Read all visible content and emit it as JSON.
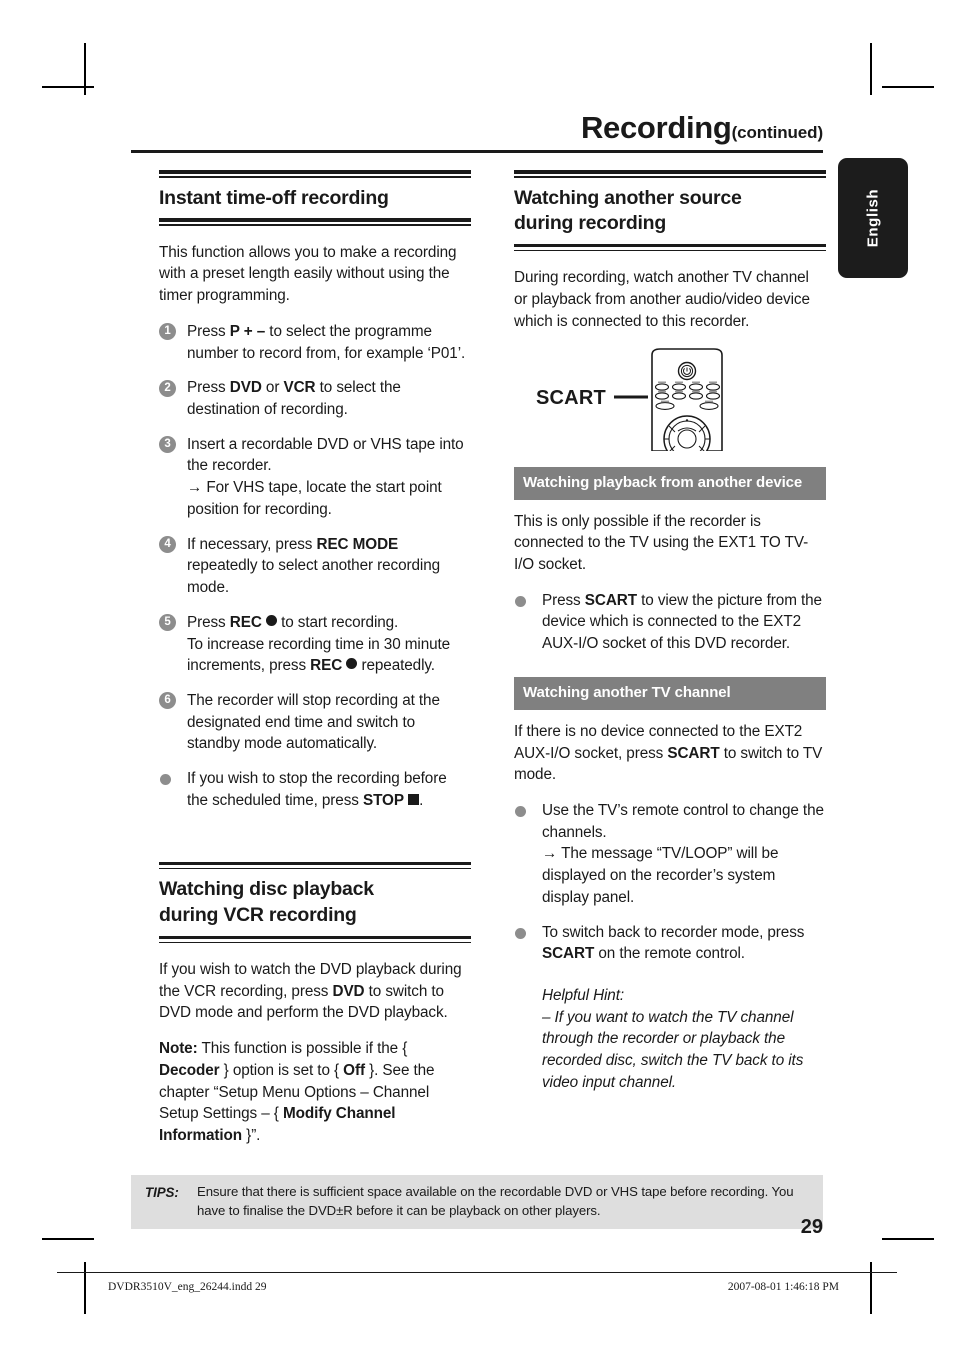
{
  "header": {
    "title": "Recording",
    "subtitle": "(continued)"
  },
  "language_tab": {
    "label": "English"
  },
  "left_column": {
    "section1": {
      "heading": "Instant time-off recording",
      "intro": "This function allows you to make a recording with a preset length easily without using the timer programming.",
      "steps": [
        {
          "num": "1",
          "parts_before": "Press ",
          "bold1": "P",
          "plus_minus": " + – ",
          "parts_after": "to select the programme number to record from, for example ‘P01’."
        },
        {
          "num": "2",
          "parts_before": "Press ",
          "bold1": "DVD",
          "mid": " or ",
          "bold2": "VCR",
          "parts_after": " to select the destination of recording."
        },
        {
          "num": "3",
          "text": "Insert a recordable DVD or VHS tape into the recorder.",
          "sub_arrow": "→",
          "sub_text": "For VHS tape, locate the start point position for recording."
        },
        {
          "num": "4",
          "parts_before": "If necessary, press ",
          "bold1": "REC MODE",
          "parts_after": " repeatedly to select another recording mode."
        },
        {
          "num": "5",
          "line1_before": "Press ",
          "line1_bold": "REC",
          "line1_after": " to start recording.",
          "line2_before": "To increase recording time in 30 minute increments, press ",
          "line2_bold": "REC",
          "line2_after": " repeatedly."
        },
        {
          "num": "6",
          "text": "The recorder will stop recording at the designated end time and switch to standby mode automatically."
        }
      ],
      "bullet": {
        "before": "If you wish to stop the recording before the scheduled time, press ",
        "bold": "STOP",
        "after": "."
      }
    },
    "section2": {
      "heading_line1": "Watching disc playback",
      "heading_line2": "during VCR recording",
      "para1_before": "If you wish to watch the DVD playback during the VCR recording, press ",
      "para1_bold": "DVD",
      "para1_after": " to switch to DVD mode and perform the DVD playback.",
      "note_label": "Note:",
      "note_p1": " This function is possible if the { ",
      "note_b1": "Decoder",
      "note_p2": " } option is set to { ",
      "note_b2": "Off",
      "note_p3": " }. See the chapter “Setup Menu Options – Channel Setup Settings – { ",
      "note_b3": "Modify Channel Information",
      "note_p4": " }”."
    }
  },
  "right_column": {
    "section1": {
      "heading_line1": "Watching another source",
      "heading_line2": "during recording",
      "intro": "During recording, watch another TV channel or playback from another audio/video device which is connected to this recorder.",
      "figure": {
        "label": "SCART",
        "icon": "remote-control-illustration"
      }
    },
    "banner1": {
      "text": "Watching playback from another device"
    },
    "banner1_body": "This is only possible if the recorder is connected to the TV using the EXT1 TO TV-I/O socket.",
    "bullet1": {
      "before": "Press ",
      "bold": "SCART",
      "after": " to view the picture from the device which is connected to the EXT2 AUX-I/O socket of this DVD recorder."
    },
    "banner2": {
      "text": "Watching another TV channel"
    },
    "banner2_body_before": "If there is no device connected to the EXT2 AUX-I/O socket, press ",
    "banner2_body_bold": "SCART",
    "banner2_body_after": " to switch to TV mode.",
    "bullet2": {
      "text": "Use the TV’s remote control to change the channels.",
      "sub_arrow": "→",
      "sub_text": "The message “TV/LOOP” will be displayed on the recorder’s system display panel."
    },
    "bullet3": {
      "before": "To switch back to recorder mode, press ",
      "bold": "SCART",
      "after": " on the remote control."
    },
    "hint": {
      "label": "Helpful Hint:",
      "text": "– If you want to watch the TV channel through the recorder or playback the recorded disc, switch the TV back to its video input channel."
    }
  },
  "tips": {
    "label": "TIPS:",
    "text": "Ensure that there is sufficient space available on the recordable DVD or VHS tape before recording. You have to finalise the DVD±R before it can be playback on other players."
  },
  "page_number": "29",
  "footer": {
    "left": "DVDR3510V_eng_26244.indd   29",
    "right": "2007-08-01   1:46:18 PM"
  },
  "colors": {
    "banner_gray": "#808080",
    "bullet_gray": "#8d8d8d",
    "tips_gray": "#dedede",
    "tab_black": "#1c1c1c"
  }
}
